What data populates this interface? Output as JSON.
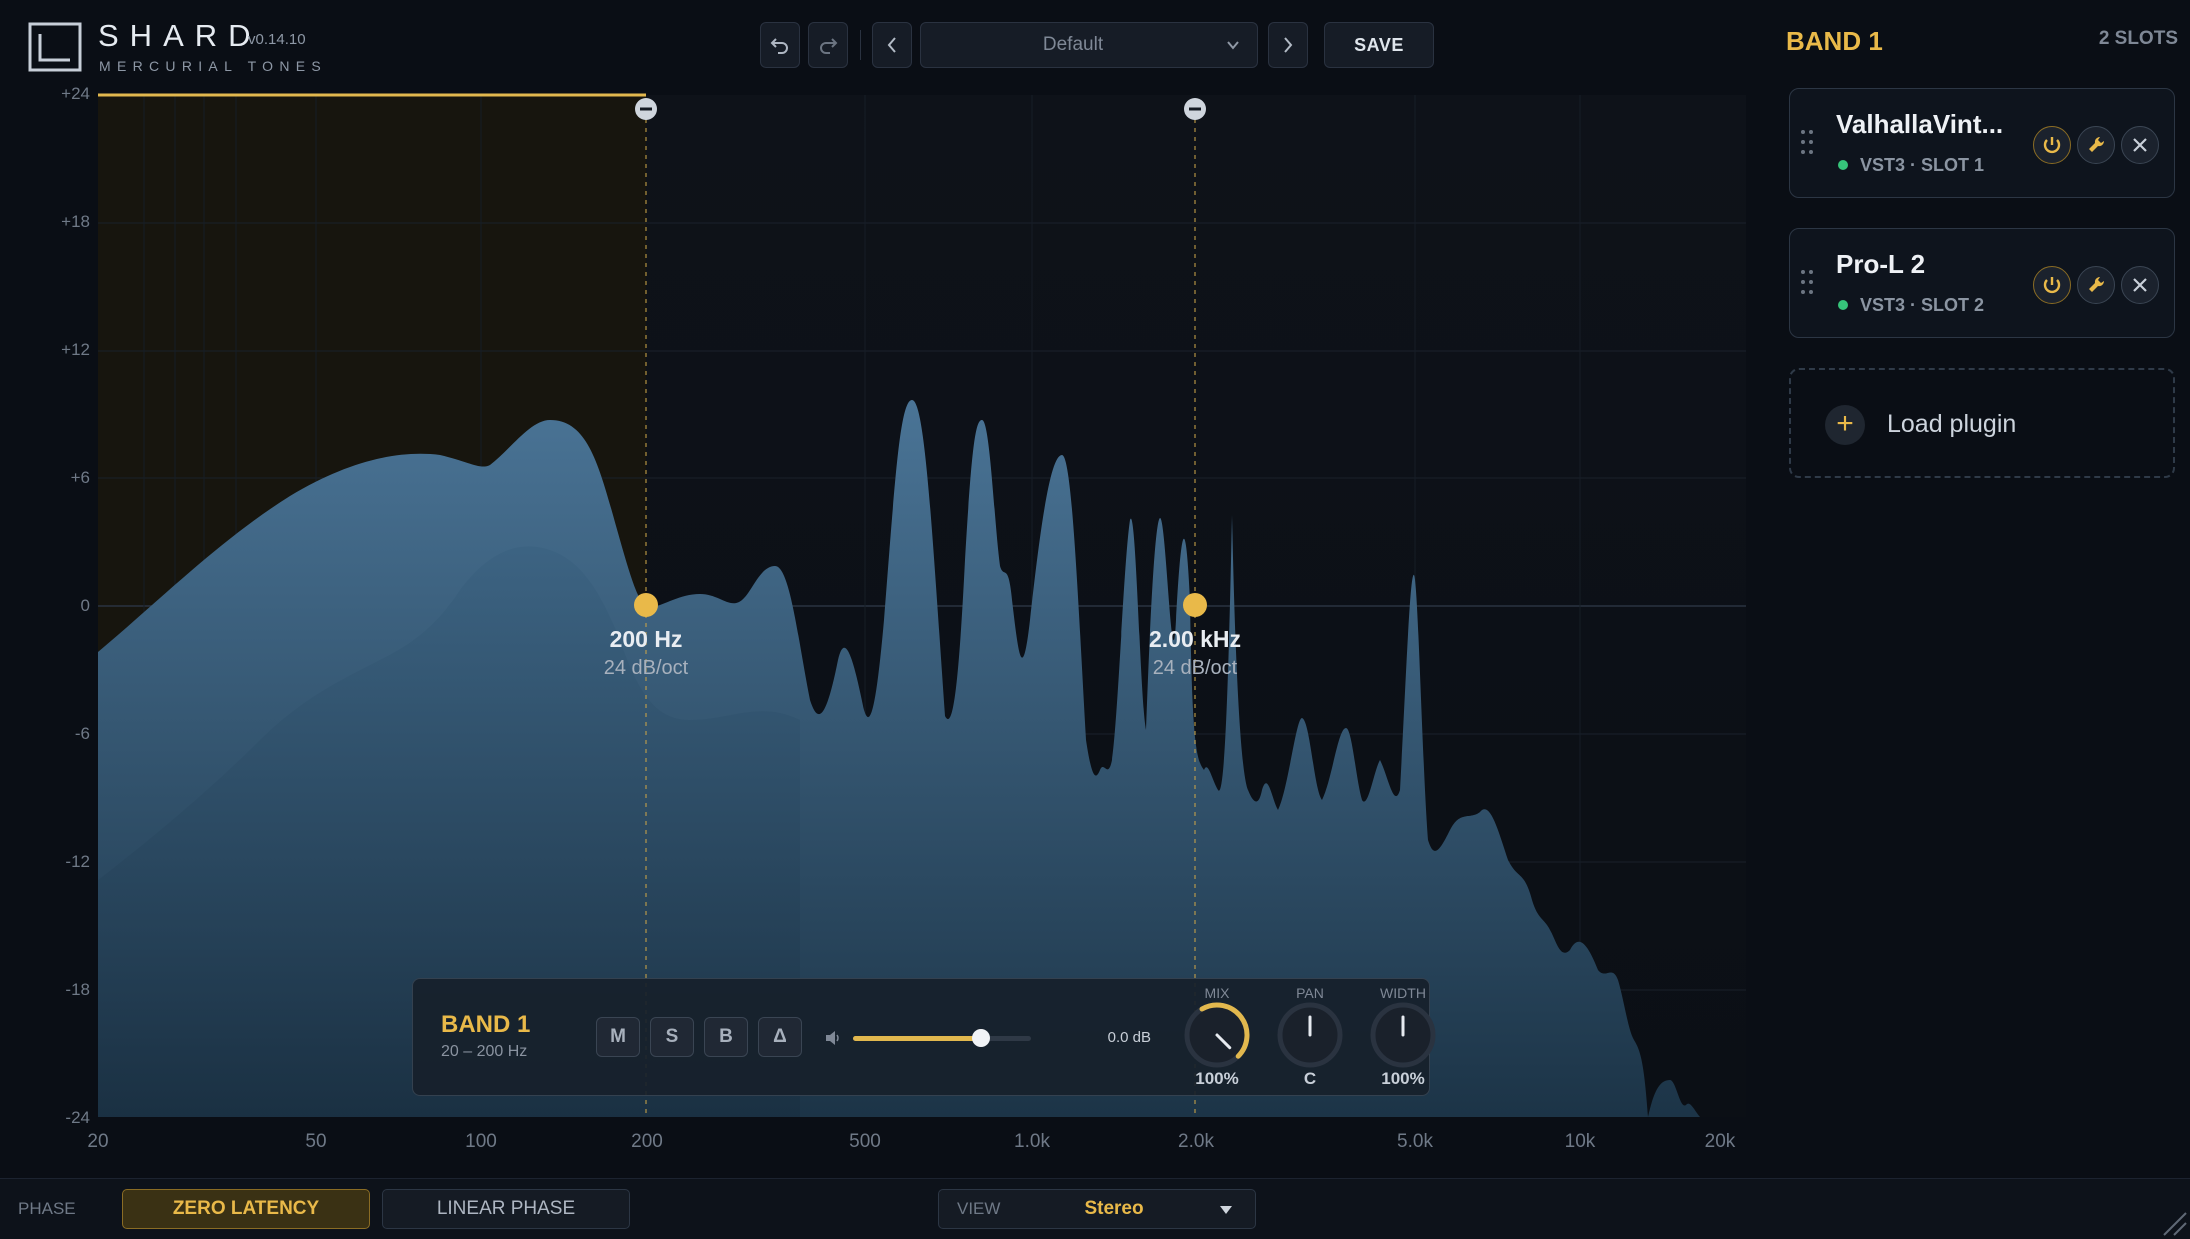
{
  "app": {
    "name": "SHARD",
    "version": "v0.14.10",
    "vendor": "MERCURIAL TONES"
  },
  "toolbar": {
    "undo_icon": "undo-icon",
    "redo_icon": "redo-icon",
    "preset_name": "Default",
    "save_label": "SAVE"
  },
  "graph": {
    "y_ticks": [
      "+24",
      "+18",
      "+12",
      "+6",
      "0",
      "-6",
      "-12",
      "-18",
      "-24"
    ],
    "x_ticks": [
      "20",
      "50",
      "100",
      "200",
      "500",
      "1.0k",
      "2.0k",
      "5.0k",
      "10k",
      "20k"
    ],
    "nodes": [
      {
        "freq": "200 Hz",
        "slope": "24 dB/oct"
      },
      {
        "freq": "2.00 kHz",
        "slope": "24 dB/oct"
      }
    ]
  },
  "band_panel": {
    "title": "BAND 1",
    "range": "20 – 200 Hz",
    "buttons": [
      "M",
      "S",
      "B",
      "Δ"
    ],
    "volume_level": 0.72,
    "gain_value": "0.0 dB",
    "knobs": [
      {
        "label": "MIX",
        "value": "100%",
        "level": 1.0
      },
      {
        "label": "PAN",
        "value": "C",
        "level": 0.5
      },
      {
        "label": "WIDTH",
        "value": "100%",
        "level": 0.5
      }
    ]
  },
  "footer": {
    "phase_label": "PHASE",
    "phase_options": [
      "ZERO LATENCY",
      "LINEAR PHASE"
    ],
    "view_label": "VIEW",
    "view_value": "Stereo"
  },
  "side": {
    "title": "BAND 1",
    "slot_count": "2 SLOTS",
    "slots": [
      {
        "name": "ValhallaVint...",
        "meta": "VST3 · SLOT 1"
      },
      {
        "name": "Pro-L 2",
        "meta": "VST3 · SLOT 2"
      }
    ],
    "load_label": "Load plugin"
  },
  "colors": {
    "accent": "#e9b949",
    "background": "#0a0e15",
    "spectrum": "#4d7696",
    "active_dot": "#36c47a"
  }
}
